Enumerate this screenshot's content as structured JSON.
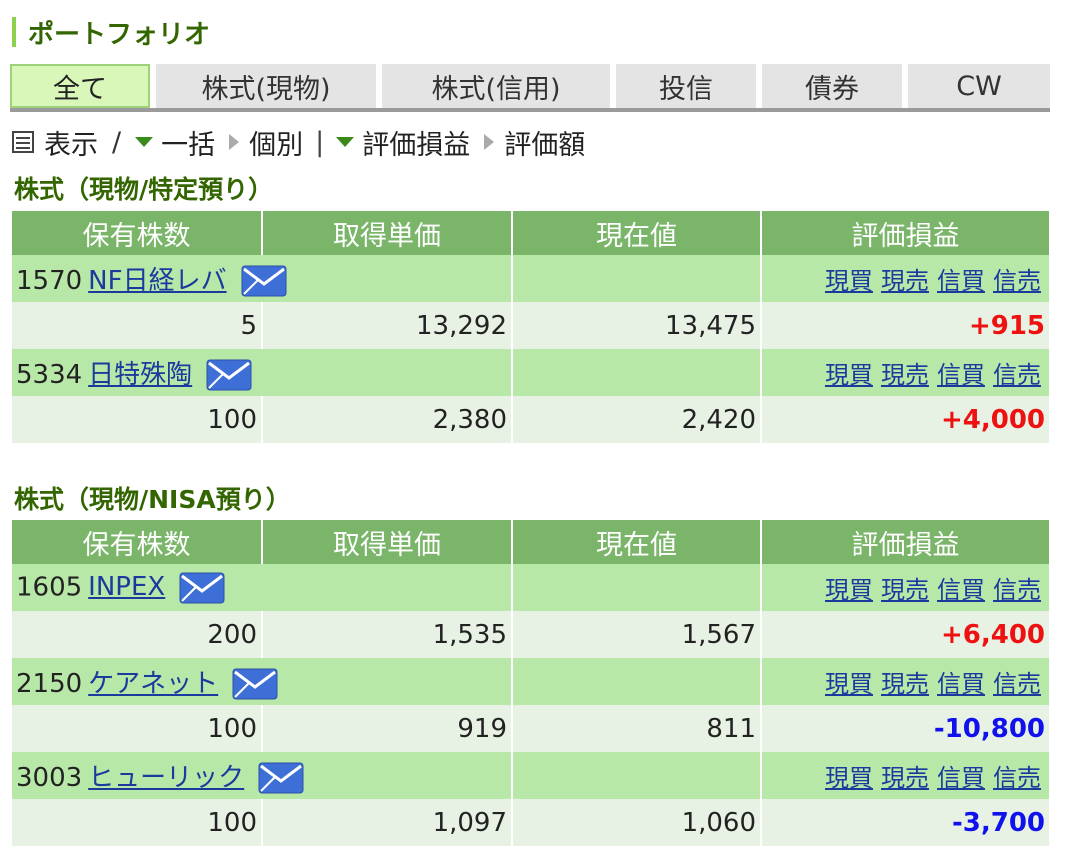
{
  "page": {
    "title": "ポートフォリオ"
  },
  "tabs": [
    {
      "label": "全て",
      "active": true
    },
    {
      "label": "株式(現物)",
      "active": false
    },
    {
      "label": "株式(信用)",
      "active": false
    },
    {
      "label": "投信",
      "active": false
    },
    {
      "label": "債券",
      "active": false
    },
    {
      "label": "CW",
      "active": false
    }
  ],
  "view_bar": {
    "display_label": "表示",
    "slash": "/",
    "bulk_label": "一括",
    "individual_label": "個別",
    "divider": "|",
    "pl_label": "評価損益",
    "value_label": "評価額"
  },
  "trade_links": [
    "現買",
    "現売",
    "信買",
    "信売"
  ],
  "sections": [
    {
      "title": "株式（現物/特定預り）",
      "headers": [
        "保有株数",
        "取得単価",
        "現在値",
        "評価損益"
      ],
      "rows": [
        {
          "code": "1570",
          "name": "NF日経レバ",
          "shares": "5",
          "cost": "13,292",
          "price": "13,475",
          "pl": "+915",
          "pl_sign": "pos"
        },
        {
          "code": "5334",
          "name": "日特殊陶",
          "shares": "100",
          "cost": "2,380",
          "price": "2,420",
          "pl": "+4,000",
          "pl_sign": "pos"
        }
      ]
    },
    {
      "title": "株式（現物/NISA預り）",
      "headers": [
        "保有株数",
        "取得単価",
        "現在値",
        "評価損益"
      ],
      "rows": [
        {
          "code": "1605",
          "name": "INPEX",
          "shares": "200",
          "cost": "1,535",
          "price": "1,567",
          "pl": "+6,400",
          "pl_sign": "pos"
        },
        {
          "code": "2150",
          "name": "ケアネット",
          "shares": "100",
          "cost": "919",
          "price": "811",
          "pl": "-10,800",
          "pl_sign": "neg"
        },
        {
          "code": "3003",
          "name": "ヒューリック",
          "shares": "100",
          "cost": "1,097",
          "price": "1,060",
          "pl": "-3,700",
          "pl_sign": "neg"
        }
      ]
    }
  ],
  "colors": {
    "accent_green": "#336600",
    "header_green": "#7ab56a",
    "row_green": "#b8e8a8",
    "row_light": "#e8f2e4",
    "profit": "#ee1111",
    "loss": "#1111ee",
    "link": "#1a3a9e"
  }
}
